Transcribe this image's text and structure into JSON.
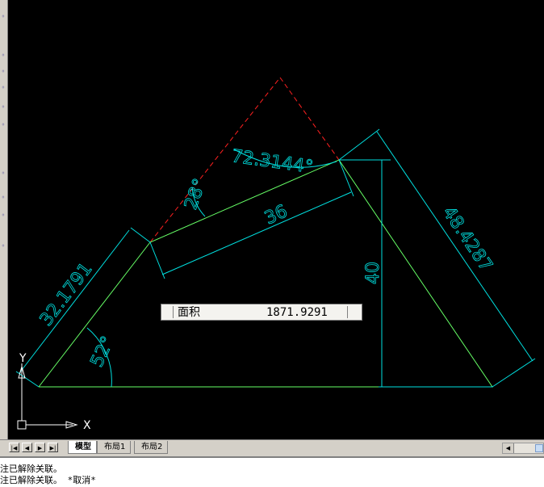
{
  "left_toolbar": {
    "icons": [
      "command-icon",
      "icon-2",
      "icon-3",
      "icon-4",
      "icon-5",
      "icon-6",
      "icon-7",
      "icon-8",
      "icon-9",
      "icon-10"
    ]
  },
  "drawing": {
    "dimensions": {
      "left_side": "32.1791",
      "right_side": "48.4287",
      "top_segment": "36",
      "height": "40",
      "apex_angle": "72.3144°",
      "top_angle": "28°",
      "base_angle": "52°"
    },
    "ucs": {
      "x_label": "X",
      "y_label": "Y"
    },
    "colors": {
      "background": "#000000",
      "triangle": "#66ff66",
      "dimension": "#00e0e0",
      "hidden_line": "#ff2020",
      "ucs": "#ffffff"
    }
  },
  "area_tooltip": {
    "label": "面积",
    "value": "1871.9291"
  },
  "tabs": {
    "nav": [
      "first",
      "prev",
      "next",
      "last"
    ],
    "items": [
      {
        "label": "模型",
        "active": true
      },
      {
        "label": "布局1",
        "active": false
      },
      {
        "label": "布局2",
        "active": false
      }
    ]
  },
  "command_history": [
    "注已解除关联。",
    "注已解除关联。 *取消*"
  ]
}
